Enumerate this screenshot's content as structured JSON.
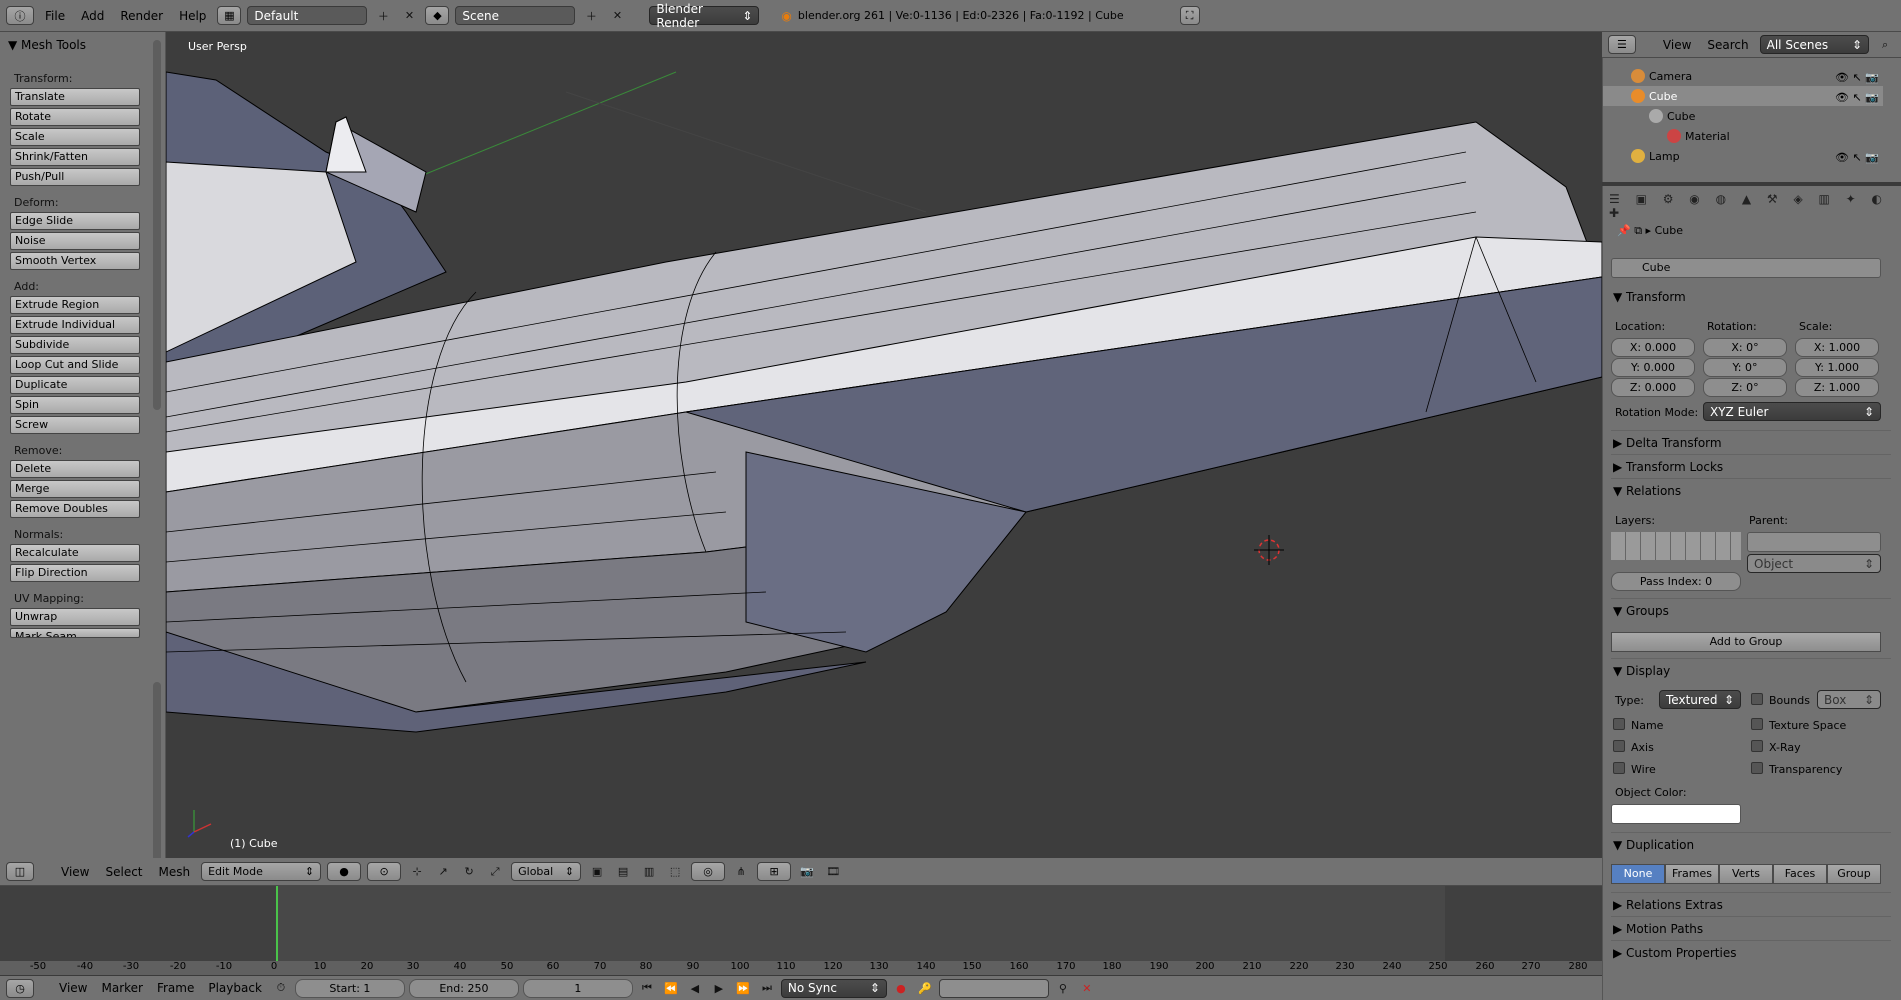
{
  "topbar": {
    "menus": [
      "File",
      "Add",
      "Render",
      "Help"
    ],
    "layout": "Default",
    "scene": "Scene",
    "engine": "Blender Render",
    "info": "blender.org 261 | Ve:0-1136 | Ed:0-2326 | Fa:0-1192 | Cube"
  },
  "toolshelf": {
    "title": "Mesh Tools",
    "sections": [
      {
        "label": "Transform:",
        "buttons": [
          "Translate",
          "Rotate",
          "Scale",
          "Shrink/Fatten",
          "Push/Pull"
        ]
      },
      {
        "label": "Deform:",
        "buttons": [
          "Edge Slide",
          "Noise",
          "Smooth Vertex"
        ]
      },
      {
        "label": "Add:",
        "buttons": [
          "Extrude Region",
          "Extrude Individual",
          "Subdivide",
          "Loop Cut and Slide",
          "Duplicate",
          "Spin",
          "Screw"
        ]
      },
      {
        "label": "Remove:",
        "buttons": [
          "Delete",
          "Merge",
          "Remove Doubles"
        ]
      },
      {
        "label": "Normals:",
        "buttons": [
          "Recalculate",
          "Flip Direction"
        ]
      },
      {
        "label": "UV Mapping:",
        "buttons": [
          "Unwrap",
          "Mark Seam"
        ]
      }
    ]
  },
  "viewport": {
    "label": "User Persp",
    "object": "(1) Cube"
  },
  "viewport_header": {
    "menus": [
      "View",
      "Select",
      "Mesh"
    ],
    "mode": "Edit Mode",
    "orientation": "Global"
  },
  "outliner": {
    "menus": [
      "View",
      "Search"
    ],
    "filter": "All Scenes",
    "items": [
      "Camera",
      "Cube",
      "Cube",
      "Material",
      "Lamp"
    ]
  },
  "properties": {
    "breadcrumb": "Cube",
    "object_name": "Cube",
    "transform": {
      "title": "Transform",
      "location_label": "Location:",
      "rotation_label": "Rotation:",
      "scale_label": "Scale:",
      "location": [
        "X: 0.000",
        "Y: 0.000",
        "Z: 0.000"
      ],
      "rotation": [
        "X: 0°",
        "Y: 0°",
        "Z: 0°"
      ],
      "scale": [
        "X: 1.000",
        "Y: 1.000",
        "Z: 1.000"
      ],
      "rotation_mode_label": "Rotation Mode:",
      "rotation_mode": "XYZ Euler"
    },
    "collapsed_1": [
      "Delta Transform",
      "Transform Locks"
    ],
    "relations": {
      "title": "Relations",
      "layers_label": "Layers:",
      "parent_label": "Parent:",
      "parent_type": "Object",
      "pass_index": "Pass Index: 0"
    },
    "groups": {
      "title": "Groups",
      "add": "Add to Group"
    },
    "display": {
      "title": "Display",
      "type_label": "Type:",
      "type": "Textured",
      "bounds": "Bounds",
      "bounds_type": "Box",
      "left": [
        "Name",
        "Axis",
        "Wire"
      ],
      "right": [
        "Texture Space",
        "X-Ray",
        "Transparency"
      ],
      "color_label": "Object Color:"
    },
    "duplication": {
      "title": "Duplication",
      "options": [
        "None",
        "Frames",
        "Verts",
        "Faces",
        "Group"
      ]
    },
    "collapsed_2": [
      "Relations Extras",
      "Motion Paths",
      "Custom Properties"
    ]
  },
  "timeline": {
    "ticks": [
      "-50",
      "-40",
      "-30",
      "-20",
      "-10",
      "0",
      "10",
      "20",
      "30",
      "40",
      "50",
      "60",
      "70",
      "80",
      "90",
      "100",
      "110",
      "120",
      "130",
      "140",
      "150",
      "160",
      "170",
      "180",
      "190",
      "200",
      "210",
      "220",
      "230",
      "240",
      "250",
      "260",
      "270",
      "280"
    ],
    "menus": [
      "View",
      "Marker",
      "Frame",
      "Playback"
    ],
    "start": "Start: 1",
    "end": "End: 250",
    "current": "1",
    "sync": "No Sync"
  }
}
